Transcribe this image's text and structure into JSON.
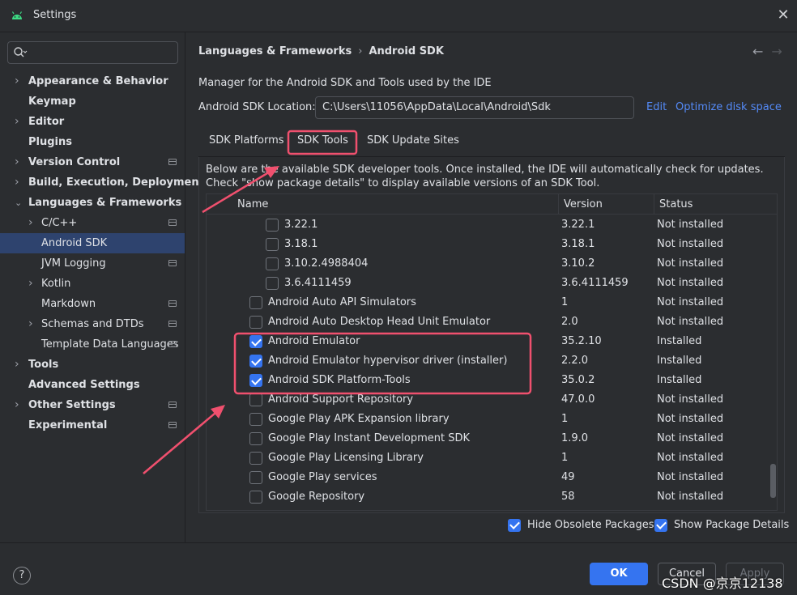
{
  "window": {
    "title": "Settings"
  },
  "sidebar": {
    "search_placeholder": "",
    "items": [
      {
        "label": "Appearance & Behavior",
        "chevron": "right",
        "bold": true
      },
      {
        "label": "Keymap",
        "bold": true
      },
      {
        "label": "Editor",
        "chevron": "right",
        "bold": true
      },
      {
        "label": "Plugins",
        "bold": true
      },
      {
        "label": "Version Control",
        "chevron": "right",
        "bold": true,
        "project": true
      },
      {
        "label": "Build, Execution, Deployment",
        "chevron": "right",
        "bold": true
      },
      {
        "label": "Languages & Frameworks",
        "chevron": "down",
        "bold": true
      },
      {
        "label": "C/C++",
        "chevron": "right",
        "project": true
      },
      {
        "label": "Android SDK",
        "selected": true
      },
      {
        "label": "JVM Logging",
        "project": true
      },
      {
        "label": "Kotlin",
        "chevron": "right"
      },
      {
        "label": "Markdown",
        "project": true
      },
      {
        "label": "Schemas and DTDs",
        "chevron": "right",
        "project": true
      },
      {
        "label": "Template Data Languages",
        "project": true
      },
      {
        "label": "Tools",
        "chevron": "right",
        "bold": true
      },
      {
        "label": "Advanced Settings",
        "bold": true
      },
      {
        "label": "Other Settings",
        "chevron": "right",
        "bold": true,
        "project": true
      },
      {
        "label": "Experimental",
        "bold": true,
        "project": true
      }
    ]
  },
  "breadcrumb": {
    "parent": "Languages & Frameworks",
    "current": "Android SDK"
  },
  "main": {
    "description": "Manager for the Android SDK and Tools used by the IDE",
    "location_label": "Android SDK Location:",
    "location_value": "C:\\Users\\11056\\AppData\\Local\\Android\\Sdk",
    "edit_link": "Edit",
    "optimize_link": "Optimize disk space",
    "tabs": [
      {
        "label": "SDK Platforms"
      },
      {
        "label": "SDK Tools",
        "active": true
      },
      {
        "label": "SDK Update Sites"
      }
    ],
    "note": "Below are the available SDK developer tools. Once installed, the IDE will automatically check for updates. Check \"show package details\" to display available versions of an SDK Tool.",
    "columns": {
      "name": "Name",
      "version": "Version",
      "status": "Status"
    },
    "rows": [
      {
        "name": "3.22.1",
        "version": "3.22.1",
        "status": "Not installed",
        "checked": false,
        "level": 2
      },
      {
        "name": "3.18.1",
        "version": "3.18.1",
        "status": "Not installed",
        "checked": false,
        "level": 2
      },
      {
        "name": "3.10.2.4988404",
        "version": "3.10.2",
        "status": "Not installed",
        "checked": false,
        "level": 2
      },
      {
        "name": "3.6.4111459",
        "version": "3.6.4111459",
        "status": "Not installed",
        "checked": false,
        "level": 2
      },
      {
        "name": "Android Auto API Simulators",
        "version": "1",
        "status": "Not installed",
        "checked": false,
        "level": 1
      },
      {
        "name": "Android Auto Desktop Head Unit Emulator",
        "version": "2.0",
        "status": "Not installed",
        "checked": false,
        "level": 1
      },
      {
        "name": "Android Emulator",
        "version": "35.2.10",
        "status": "Installed",
        "checked": true,
        "level": 1
      },
      {
        "name": "Android Emulator hypervisor driver (installer)",
        "version": "2.2.0",
        "status": "Installed",
        "checked": true,
        "level": 1
      },
      {
        "name": "Android SDK Platform-Tools",
        "version": "35.0.2",
        "status": "Installed",
        "checked": true,
        "level": 1
      },
      {
        "name": "Android Support Repository",
        "version": "47.0.0",
        "status": "Not installed",
        "checked": false,
        "level": 1
      },
      {
        "name": "Google Play APK Expansion library",
        "version": "1",
        "status": "Not installed",
        "checked": false,
        "level": 1
      },
      {
        "name": "Google Play Instant Development SDK",
        "version": "1.9.0",
        "status": "Not installed",
        "checked": false,
        "level": 1
      },
      {
        "name": "Google Play Licensing Library",
        "version": "1",
        "status": "Not installed",
        "checked": false,
        "level": 1
      },
      {
        "name": "Google Play services",
        "version": "49",
        "status": "Not installed",
        "checked": false,
        "level": 1
      },
      {
        "name": "Google Repository",
        "version": "58",
        "status": "Not installed",
        "checked": false,
        "level": 1
      }
    ],
    "hide_obsolete": "Hide Obsolete Packages",
    "show_details": "Show Package Details"
  },
  "footer": {
    "help": "?",
    "ok": "OK",
    "cancel": "Cancel",
    "apply": "Apply",
    "watermark": "CSDN @京京12138"
  },
  "colors": {
    "accent": "#3574f0",
    "link": "#548af7",
    "annotation": "#f0506e",
    "selected": "#2e436e"
  },
  "icons": [
    "android-icon",
    "close-icon",
    "search-icon",
    "back-arrow-icon",
    "forward-arrow-icon",
    "help-icon"
  ]
}
